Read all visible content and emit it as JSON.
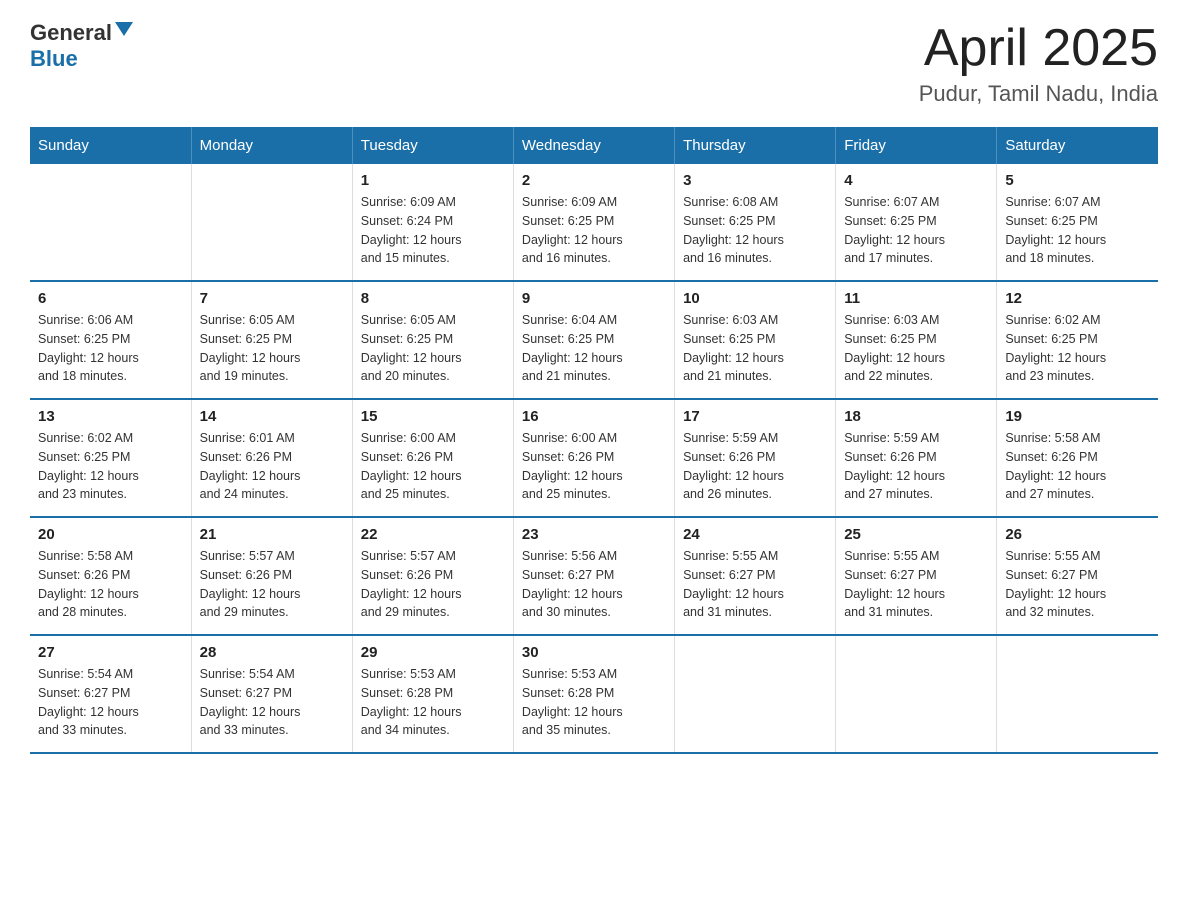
{
  "header": {
    "logo_general": "General",
    "logo_blue": "Blue",
    "title": "April 2025",
    "subtitle": "Pudur, Tamil Nadu, India"
  },
  "weekdays": [
    "Sunday",
    "Monday",
    "Tuesday",
    "Wednesday",
    "Thursday",
    "Friday",
    "Saturday"
  ],
  "weeks": [
    [
      {
        "num": "",
        "info": ""
      },
      {
        "num": "",
        "info": ""
      },
      {
        "num": "1",
        "info": "Sunrise: 6:09 AM\nSunset: 6:24 PM\nDaylight: 12 hours\nand 15 minutes."
      },
      {
        "num": "2",
        "info": "Sunrise: 6:09 AM\nSunset: 6:25 PM\nDaylight: 12 hours\nand 16 minutes."
      },
      {
        "num": "3",
        "info": "Sunrise: 6:08 AM\nSunset: 6:25 PM\nDaylight: 12 hours\nand 16 minutes."
      },
      {
        "num": "4",
        "info": "Sunrise: 6:07 AM\nSunset: 6:25 PM\nDaylight: 12 hours\nand 17 minutes."
      },
      {
        "num": "5",
        "info": "Sunrise: 6:07 AM\nSunset: 6:25 PM\nDaylight: 12 hours\nand 18 minutes."
      }
    ],
    [
      {
        "num": "6",
        "info": "Sunrise: 6:06 AM\nSunset: 6:25 PM\nDaylight: 12 hours\nand 18 minutes."
      },
      {
        "num": "7",
        "info": "Sunrise: 6:05 AM\nSunset: 6:25 PM\nDaylight: 12 hours\nand 19 minutes."
      },
      {
        "num": "8",
        "info": "Sunrise: 6:05 AM\nSunset: 6:25 PM\nDaylight: 12 hours\nand 20 minutes."
      },
      {
        "num": "9",
        "info": "Sunrise: 6:04 AM\nSunset: 6:25 PM\nDaylight: 12 hours\nand 21 minutes."
      },
      {
        "num": "10",
        "info": "Sunrise: 6:03 AM\nSunset: 6:25 PM\nDaylight: 12 hours\nand 21 minutes."
      },
      {
        "num": "11",
        "info": "Sunrise: 6:03 AM\nSunset: 6:25 PM\nDaylight: 12 hours\nand 22 minutes."
      },
      {
        "num": "12",
        "info": "Sunrise: 6:02 AM\nSunset: 6:25 PM\nDaylight: 12 hours\nand 23 minutes."
      }
    ],
    [
      {
        "num": "13",
        "info": "Sunrise: 6:02 AM\nSunset: 6:25 PM\nDaylight: 12 hours\nand 23 minutes."
      },
      {
        "num": "14",
        "info": "Sunrise: 6:01 AM\nSunset: 6:26 PM\nDaylight: 12 hours\nand 24 minutes."
      },
      {
        "num": "15",
        "info": "Sunrise: 6:00 AM\nSunset: 6:26 PM\nDaylight: 12 hours\nand 25 minutes."
      },
      {
        "num": "16",
        "info": "Sunrise: 6:00 AM\nSunset: 6:26 PM\nDaylight: 12 hours\nand 25 minutes."
      },
      {
        "num": "17",
        "info": "Sunrise: 5:59 AM\nSunset: 6:26 PM\nDaylight: 12 hours\nand 26 minutes."
      },
      {
        "num": "18",
        "info": "Sunrise: 5:59 AM\nSunset: 6:26 PM\nDaylight: 12 hours\nand 27 minutes."
      },
      {
        "num": "19",
        "info": "Sunrise: 5:58 AM\nSunset: 6:26 PM\nDaylight: 12 hours\nand 27 minutes."
      }
    ],
    [
      {
        "num": "20",
        "info": "Sunrise: 5:58 AM\nSunset: 6:26 PM\nDaylight: 12 hours\nand 28 minutes."
      },
      {
        "num": "21",
        "info": "Sunrise: 5:57 AM\nSunset: 6:26 PM\nDaylight: 12 hours\nand 29 minutes."
      },
      {
        "num": "22",
        "info": "Sunrise: 5:57 AM\nSunset: 6:26 PM\nDaylight: 12 hours\nand 29 minutes."
      },
      {
        "num": "23",
        "info": "Sunrise: 5:56 AM\nSunset: 6:27 PM\nDaylight: 12 hours\nand 30 minutes."
      },
      {
        "num": "24",
        "info": "Sunrise: 5:55 AM\nSunset: 6:27 PM\nDaylight: 12 hours\nand 31 minutes."
      },
      {
        "num": "25",
        "info": "Sunrise: 5:55 AM\nSunset: 6:27 PM\nDaylight: 12 hours\nand 31 minutes."
      },
      {
        "num": "26",
        "info": "Sunrise: 5:55 AM\nSunset: 6:27 PM\nDaylight: 12 hours\nand 32 minutes."
      }
    ],
    [
      {
        "num": "27",
        "info": "Sunrise: 5:54 AM\nSunset: 6:27 PM\nDaylight: 12 hours\nand 33 minutes."
      },
      {
        "num": "28",
        "info": "Sunrise: 5:54 AM\nSunset: 6:27 PM\nDaylight: 12 hours\nand 33 minutes."
      },
      {
        "num": "29",
        "info": "Sunrise: 5:53 AM\nSunset: 6:28 PM\nDaylight: 12 hours\nand 34 minutes."
      },
      {
        "num": "30",
        "info": "Sunrise: 5:53 AM\nSunset: 6:28 PM\nDaylight: 12 hours\nand 35 minutes."
      },
      {
        "num": "",
        "info": ""
      },
      {
        "num": "",
        "info": ""
      },
      {
        "num": "",
        "info": ""
      }
    ]
  ]
}
